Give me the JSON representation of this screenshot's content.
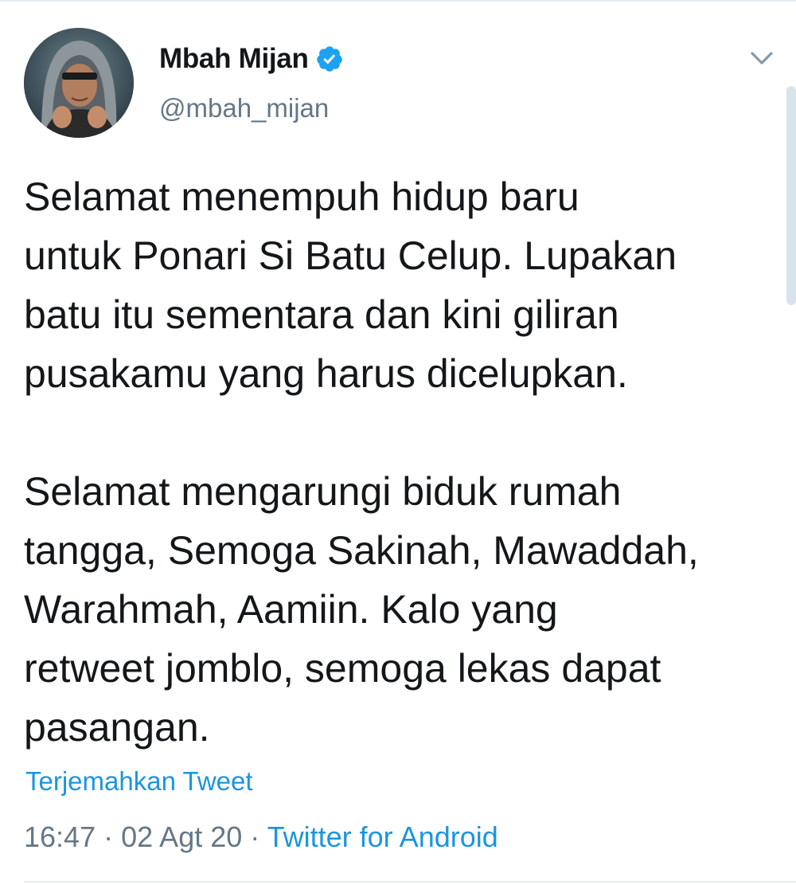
{
  "tweet": {
    "author": {
      "display_name": "Mbah Mijan",
      "handle": "@mbah_mijan",
      "verified": true,
      "avatar_icon": "hooded-person-avatar"
    },
    "text": [
      "Selamat menempuh hidup baru\nuntuk Ponari Si Batu Celup. Lupakan\nbatu itu sementara dan kini giliran\npusakamu yang harus dicelupkan.",
      "Selamat mengarungi biduk rumah\ntangga, Semoga Sakinah, Mawaddah,\nWarahmah, Aamiin. Kalo yang\nretweet jomblo, semoga lekas dapat\npasangan."
    ],
    "translate_label": "Terjemahkan Tweet",
    "time": "16:47",
    "separator": "·",
    "date": "02 Agt 20",
    "source": "Twitter for Android"
  },
  "colors": {
    "text": "#14171a",
    "secondary": "#657786",
    "link": "#1b95e0",
    "verified": "#1da1f2",
    "divider": "#e6ecf0"
  },
  "icons": {
    "menu": "chevron-down-icon",
    "verified": "verified-badge-icon"
  }
}
